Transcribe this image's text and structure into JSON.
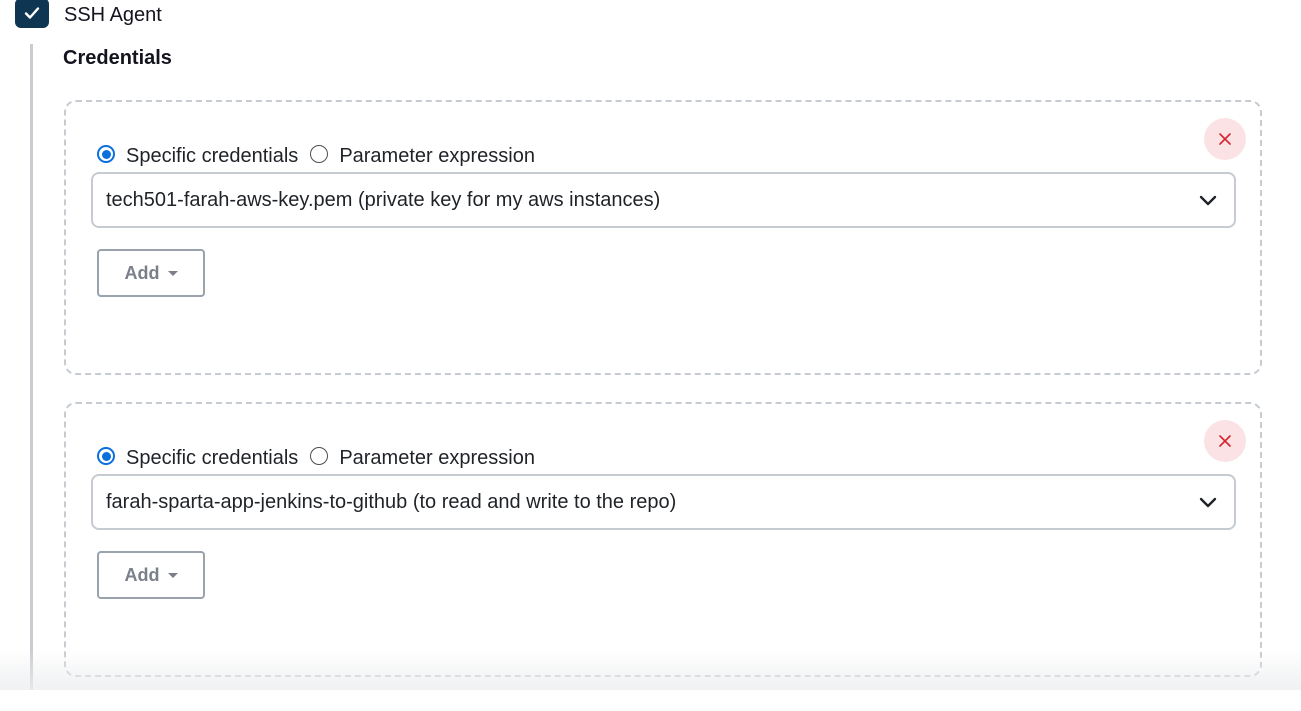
{
  "header": {
    "checkbox_checked": true,
    "label": "SSH Agent"
  },
  "section": {
    "title": "Credentials"
  },
  "credentials": [
    {
      "radio_specific_label": "Specific credentials",
      "radio_parameter_label": "Parameter expression",
      "selected_mode": "specific",
      "selected_value": "tech501-farah-aws-key.pem (private key for my aws instances)",
      "add_label": "Add",
      "remove_icon": "close-icon"
    },
    {
      "radio_specific_label": "Specific credentials",
      "radio_parameter_label": "Parameter expression",
      "selected_mode": "specific",
      "selected_value": "farah-sparta-app-jenkins-to-github (to read and write to the repo)",
      "add_label": "Add",
      "remove_icon": "close-icon"
    }
  ],
  "colors": {
    "checkbox_bg": "#0e3552",
    "radio_accent": "#0b6fde",
    "remove_bg": "#fbe3e5",
    "remove_x": "#d6242f",
    "dashed_border": "#c6cbd1"
  }
}
